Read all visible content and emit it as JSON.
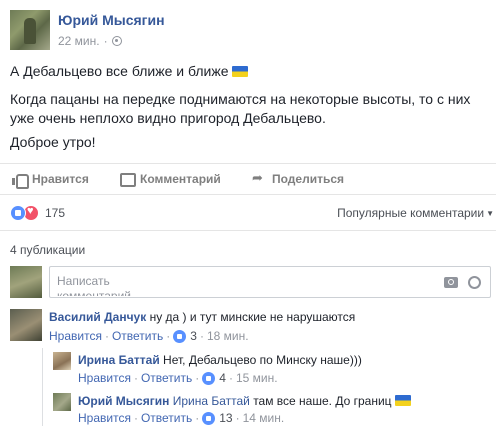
{
  "post": {
    "author": "Юрий Мысягин",
    "time": "22 мин.",
    "dot": "·",
    "line1": "А Дебальцево все ближе и ближе",
    "line2": "Когда пацаны на передке поднимаются на некоторые высоты, то с них",
    "line3": "уже очень неплохо видно пригород Дебальцево.",
    "line4": "Доброе утро!",
    "flag_colors": [
      "#2e6bd0",
      "#f3d11d"
    ]
  },
  "actions": {
    "like": "Нравится",
    "comment": "Комментарий",
    "share": "Поделиться"
  },
  "reactions": {
    "count": "175",
    "like_color": "#5890ff",
    "love_color": "#f25268"
  },
  "sort_label": "Популярные комментарии",
  "publications": "4 публикации",
  "comment_input": {
    "placeholder": "Написать комментарий..."
  },
  "comments": [
    {
      "author": "Василий Данчук",
      "text": "ну да ) и тут минские не нарушаются",
      "like": "Нравится",
      "reply": "Ответить",
      "likes": "3",
      "time": "18 мин."
    }
  ],
  "replies": [
    {
      "author": "Ирина Баттай",
      "text": "Нет, Дебальцево по Минску наше)))",
      "like": "Нравится",
      "reply": "Ответить",
      "likes": "4",
      "time": "15 мин."
    },
    {
      "author": "Юрий Мысягин",
      "mention": "Ирина Баттай",
      "text": "там все наше. До границ",
      "like": "Нравится",
      "reply": "Ответить",
      "likes": "13",
      "time": "14 мин."
    }
  ],
  "link_color": "#365899",
  "meta_color": "#90949c"
}
